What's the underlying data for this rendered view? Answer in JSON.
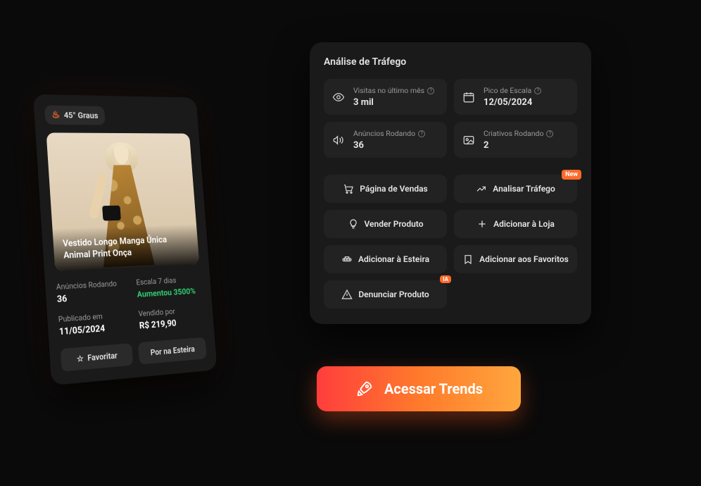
{
  "product": {
    "heat_label": "45° Graus",
    "title": "Vestido Longo Manga Única Animal Print Onça",
    "ads_running_label": "Anúncios Rodando",
    "ads_running_value": "36",
    "scale7_label": "Escala 7 dias",
    "scale7_value": "Aumentou 3500%",
    "published_label": "Publicado em",
    "published_value": "11/05/2024",
    "sold_for_label": "Vendido por",
    "sold_for_value": "R$ 219,90",
    "fav_label": "Favoritar",
    "esteira_label": "Por na Esteira"
  },
  "analysis": {
    "title": "Análise de Tráfego",
    "stats": {
      "visits_label": "Visitas no último mês",
      "visits_value": "3 mil",
      "peak_label": "Pico de Escala",
      "peak_value": "12/05/2024",
      "ads_label": "Anúncios Rodando",
      "ads_value": "36",
      "creatives_label": "Criativos Rodando",
      "creatives_value": "2"
    },
    "actions": {
      "sales_page": "Página de Vendas",
      "analyze_traffic": "Analisar Tráfego",
      "analyze_badge": "New",
      "sell_product": "Vender Produto",
      "add_store": "Adicionar à Loja",
      "add_esteira": "Adicionar à Esteira",
      "add_fav": "Adicionar aos Favoritos",
      "report": "Denunciar Produto",
      "report_badge": "IA"
    }
  },
  "cta": {
    "label": "Acessar Trends"
  }
}
